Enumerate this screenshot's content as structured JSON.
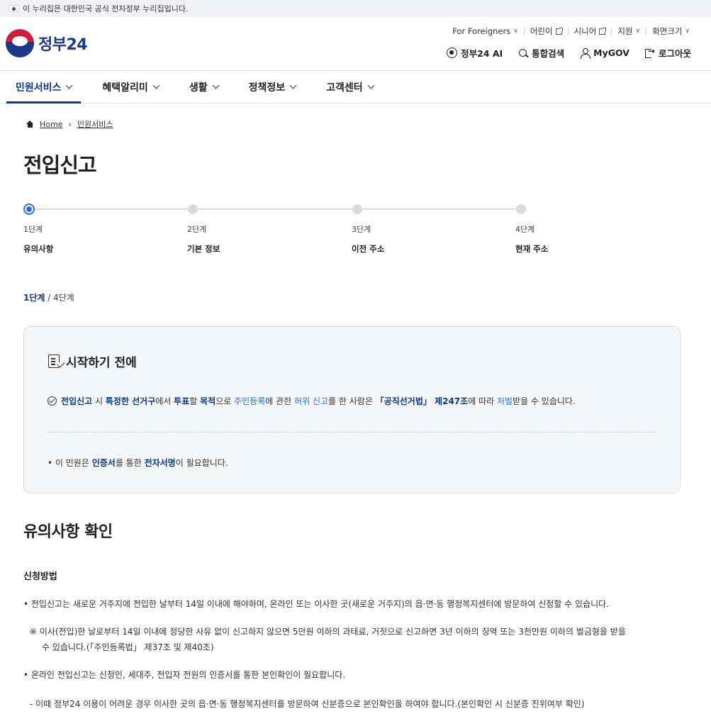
{
  "gov_banner": {
    "text": "이 누리집은 대한민국 공식 전자정부 누리집입니다."
  },
  "header": {
    "logo_text": "정부24",
    "util_top": [
      "For Foreigners",
      "어린이",
      "시니어",
      "지원",
      "화면크기"
    ],
    "util_main": [
      "정부24 AI",
      "통합검색",
      "MyGOV",
      "로그아웃"
    ]
  },
  "gnb": {
    "items": [
      "민원서비스",
      "혜택알리미",
      "생활",
      "정책정보",
      "고객센터"
    ]
  },
  "breadcrumb": {
    "home": "Home",
    "current": "민원서비스"
  },
  "page_title": "전입신고",
  "steps": [
    {
      "num": "1단계",
      "name": "유의사항"
    },
    {
      "num": "2단계",
      "name": "기본 정보"
    },
    {
      "num": "3단계",
      "name": "이전 주소"
    },
    {
      "num": "4단계",
      "name": "현재 주소"
    }
  ],
  "progress": {
    "current": "1단계",
    "total": " / 4단계"
  },
  "notice": {
    "title": "시작하기 전에",
    "warning": {
      "p1": "전입신고",
      "p2": " 시 ",
      "p3": "특정한 선거구",
      "p4": "에서 ",
      "p5": "투표",
      "p6": "할 ",
      "p7": "목적",
      "p8": "으로 ",
      "p9": "주민등록",
      "p10": "에 관한 ",
      "p11": "허위 신고",
      "p12": "를 한 사람은 ",
      "p13": "「공직선거법」 제247조",
      "p14": "에 따라 ",
      "p15": "처벌",
      "p16": "받을 수 있습니다."
    },
    "cert": {
      "p1": "• 이 민원은 ",
      "p2": "인증서",
      "p3": "를 통한 ",
      "p4": "전자서명",
      "p5": "이 필요합니다."
    }
  },
  "section": {
    "title": "유의사항 확인",
    "subtitle": "신청방법",
    "para1": "• 전입신고는 새로운 거주지에 전입한 날부터 14일 이내에 해야하며, 온라인 또는 이사한 곳(새로운 거주지)의 읍·면·동 행정복지센터에 방문하여 신청할 수 있습니다.",
    "para2_line1": "※ 이사(전입)한 날로부터 14일 이내에 정당한 사유 없이 신고하지 않으면 5만원 이하의 과태료, 거짓으로 신고하면 3년 이하의 징역 또는 3천만원 이하의 벌금형을 받을",
    "para2_line2": "수 있습니다.(「주민등록법」 제37조 및 제40조)",
    "para3": "• 온라인 전입신고는 신청인, 세대주, 전입자 전원의 인증서를 통한 본인확인이 필요합니다.",
    "para4": "- 이때 정부24 이용이 어려운 경우 이사한 곳의 읍·면·동 행정복지센터를 방문하여 신분증으로 본인확인을 하여야 합니다.(본인확인 시 신분증 진위여부 확인)"
  }
}
